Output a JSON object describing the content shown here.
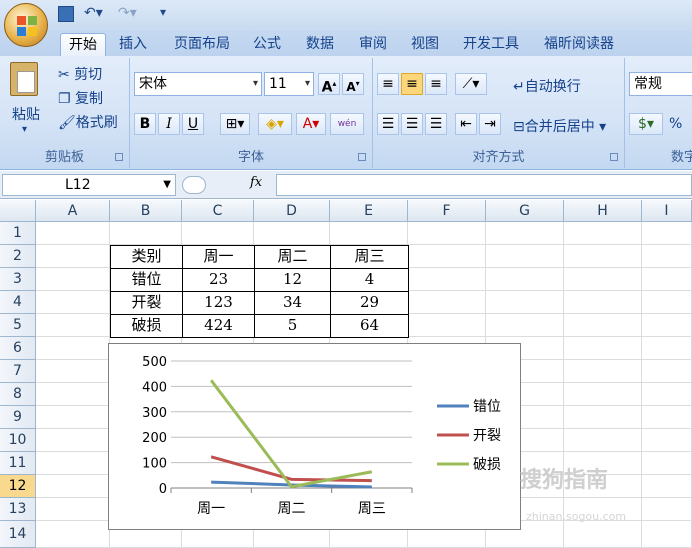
{
  "ribbon_tabs": [
    "开始",
    "插入",
    "页面布局",
    "公式",
    "数据",
    "审阅",
    "视图",
    "开发工具",
    "福昕阅读器"
  ],
  "active_tab": "开始",
  "clipboard": {
    "paste": "粘贴",
    "cut": "剪切",
    "copy": "复制",
    "format_painter": "格式刷",
    "group": "剪贴板"
  },
  "font": {
    "name": "宋体",
    "size": "11",
    "bold": "B",
    "italic": "I",
    "underline": "U",
    "group": "字体",
    "phonetic": "wén"
  },
  "alignment": {
    "wrap": "自动换行",
    "merge": "合并后居中",
    "group": "对齐方式"
  },
  "number": {
    "format": "常规",
    "percent": "%",
    "group": "数字"
  },
  "name_box": "L12",
  "fx_label": "fx",
  "columns": [
    "A",
    "B",
    "C",
    "D",
    "E",
    "F",
    "G",
    "H",
    "I"
  ],
  "rows": [
    "1",
    "2",
    "3",
    "4",
    "5",
    "6",
    "7",
    "8",
    "9",
    "10",
    "11",
    "12",
    "13",
    "14"
  ],
  "selected_row": "12",
  "table": {
    "header": [
      "类别",
      "周一",
      "周二",
      "周三"
    ],
    "rows": [
      [
        "错位",
        "23",
        "12",
        "4"
      ],
      [
        "开裂",
        "123",
        "34",
        "29"
      ],
      [
        "破损",
        "424",
        "5",
        "64"
      ]
    ]
  },
  "chart_data": {
    "type": "line",
    "categories": [
      "周一",
      "周二",
      "周三"
    ],
    "series": [
      {
        "name": "错位",
        "values": [
          23,
          12,
          4
        ],
        "color": "#4f81bd"
      },
      {
        "name": "开裂",
        "values": [
          123,
          34,
          29
        ],
        "color": "#c0504d"
      },
      {
        "name": "破损",
        "values": [
          424,
          5,
          64
        ],
        "color": "#9bbb59"
      }
    ],
    "ylim": [
      0,
      500
    ],
    "yticks": [
      0,
      100,
      200,
      300,
      400,
      500
    ],
    "legend": "right",
    "grid": true
  },
  "watermark": "搜狗指南",
  "watermark_url": "zhinan.sogou.com"
}
